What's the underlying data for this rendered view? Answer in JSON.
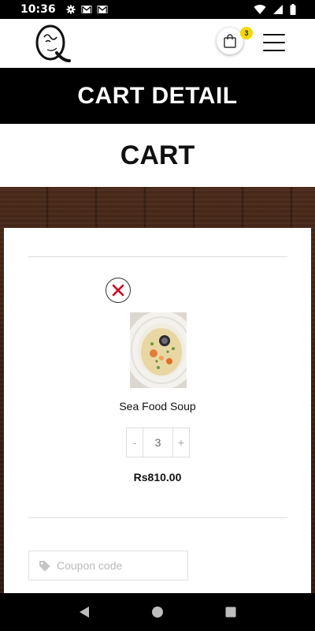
{
  "status_bar": {
    "time": "10:36",
    "icons_left": [
      "gear-icon",
      "gmail-icon",
      "gmail-icon"
    ],
    "icons_right": [
      "wifi-icon",
      "signal-icon",
      "battery-icon"
    ]
  },
  "header": {
    "logo_icon": "restaurant-logo",
    "cart_count": "3",
    "cart_icon": "shopping-bag-icon",
    "menu_icon": "hamburger-menu-icon"
  },
  "banner": {
    "title": "CART DETAIL"
  },
  "cart": {
    "heading": "CART",
    "items": [
      {
        "name": "Sea Food Soup",
        "quantity": "3",
        "decrement_label": "-",
        "increment_label": "+",
        "price": "Rs810.00",
        "remove_icon": "close-icon"
      }
    ],
    "coupon": {
      "placeholder": "Coupon code",
      "icon": "tag-icon"
    }
  },
  "colors": {
    "accent_badge": "#f5d800",
    "remove_x": "#d0021b",
    "banner_bg": "#000000",
    "wood": "#3b2014"
  },
  "nav_bar": {
    "icons": [
      "back-icon",
      "home-icon",
      "recents-icon"
    ]
  }
}
